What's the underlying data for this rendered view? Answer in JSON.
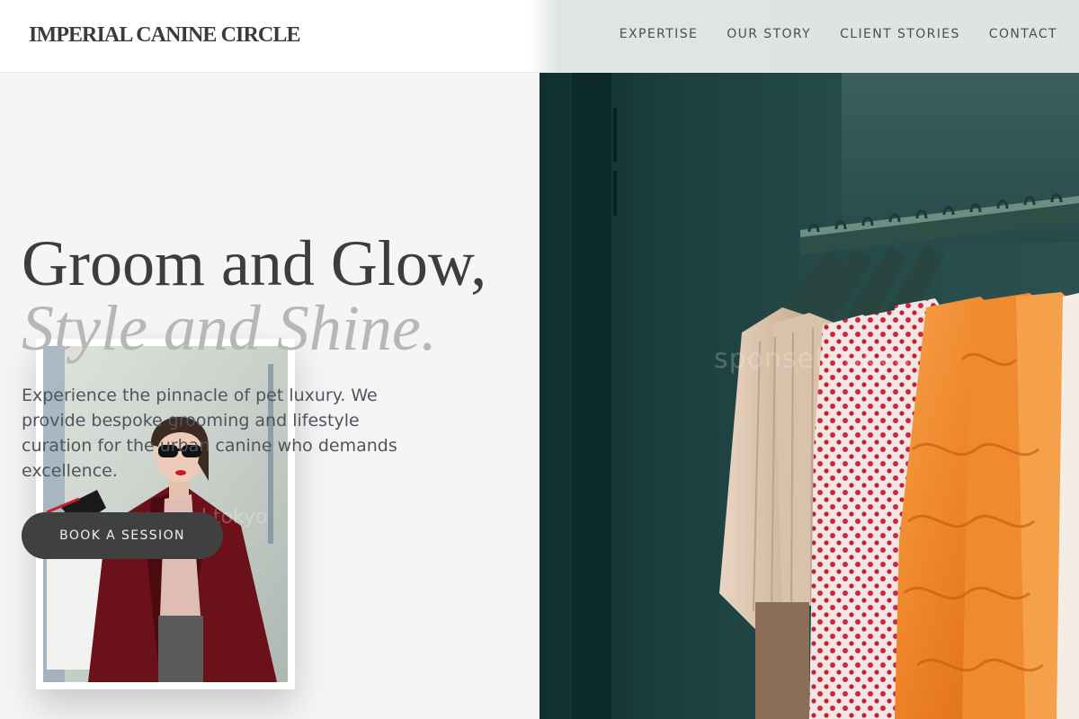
{
  "header": {
    "logo": "IMPERIAL CANINE CIRCLE",
    "nav": [
      {
        "label": "EXPERTISE"
      },
      {
        "label": "OUR STORY"
      },
      {
        "label": "CLIENT STORIES"
      },
      {
        "label": "CONTACT"
      }
    ]
  },
  "hero": {
    "headline": "Groom and Glow,",
    "headline_accent": "Style and Shine.",
    "intro": "Experience the pinnacle of pet luxury. We provide bespoke grooming and lifestyle curation for the urban canine who demands excellence.",
    "cta_label": "BOOK A SESSION"
  },
  "images": {
    "hero_photo": {
      "subject": "clothing-rack-photo",
      "watermark": "sponsel.tokyo"
    },
    "inset_photo": {
      "subject": "fashion-woman-photo",
      "watermark": "sponsel.tokyo"
    }
  },
  "colors": {
    "background": "#f5f5f5",
    "text_dark": "#3d3d3d",
    "accent_text": "#b7b7b7",
    "button": "#404040",
    "photo_teal": "#1f4444",
    "garment_orange": "#ef8a2c"
  }
}
